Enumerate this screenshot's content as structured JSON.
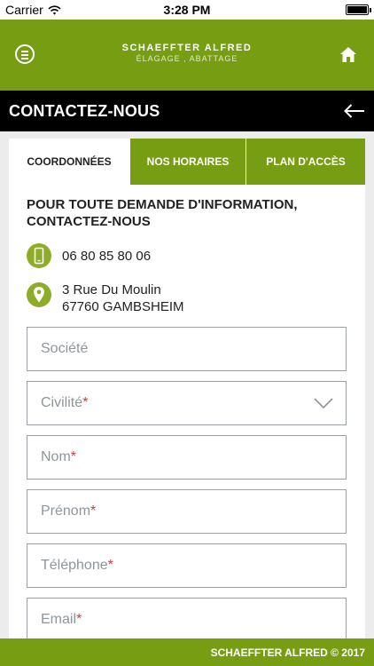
{
  "status": {
    "carrier": "Carrier",
    "time": "3:28 PM"
  },
  "header": {
    "brand_name": "SCHAEFFTER ALFRED",
    "brand_tagline": "ÉLAGAGE , ABATTAGE",
    "menu_icon": "menu-icon",
    "home_icon": "home-icon"
  },
  "page": {
    "title": "CONTACTEZ-NOUS",
    "back_icon": "arrow-left-icon"
  },
  "tabs": [
    {
      "label": "COORDONNÉES",
      "active": true
    },
    {
      "label": "NOS HORAIRES",
      "active": false
    },
    {
      "label": "PLAN D'ACCÈS",
      "active": false
    }
  ],
  "info": {
    "heading": "POUR TOUTE DEMANDE D'INFORMATION, CONTACTEZ-NOUS",
    "phone": "06 80 85 80 06",
    "address_line1": "3 Rue Du Moulin",
    "address_line2": "67760 GAMBSHEIM"
  },
  "form": {
    "societe": {
      "label": "Société"
    },
    "civilite": {
      "label": "Civilité",
      "required": "*"
    },
    "nom": {
      "label": "Nom",
      "required": "*"
    },
    "prenom": {
      "label": "Prénom",
      "required": "*"
    },
    "telephone": {
      "label": "Téléphone",
      "required": "*"
    },
    "email": {
      "label": "Email",
      "required": "*"
    }
  },
  "footer": {
    "copyright": "SCHAEFFTER ALFRED © 2017"
  },
  "colors": {
    "primary_green": "#779e13",
    "icon_green": "#8dad28",
    "title_bar": "#000000",
    "required_star": "#d9383a"
  }
}
